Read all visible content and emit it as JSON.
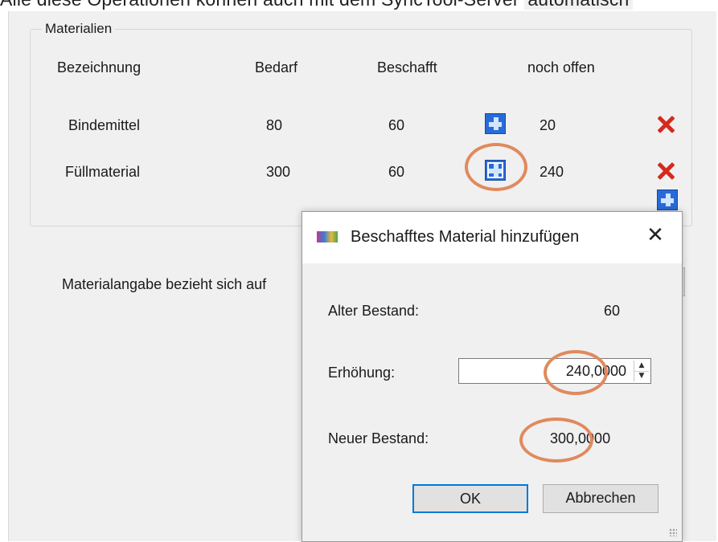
{
  "caption": {
    "text": "Alle diese Operationen können auch mit dem SyncTool-Server ",
    "highlight": "automatisch"
  },
  "group": {
    "title": "Materialien",
    "headers": {
      "name": "Bezeichnung",
      "need": "Bedarf",
      "procured": "Beschafft",
      "open": "noch offen"
    },
    "rows": [
      {
        "name": "Bindemittel",
        "need": "80",
        "procured": "60",
        "open": "20"
      },
      {
        "name": "Füllmaterial",
        "need": "300",
        "procured": "60",
        "open": "240"
      }
    ]
  },
  "material_reference_label": "Materialangabe bezieht sich auf",
  "dialog": {
    "title": "Beschafftes Material hinzufügen",
    "close_glyph": "✕",
    "old_stock_label": "Alter Bestand:",
    "old_stock_value": "60",
    "increase_label": "Erhöhung:",
    "increase_value": "240,0000",
    "new_stock_label": "Neuer Bestand:",
    "new_stock_value": "300,0000",
    "ok_label": "OK",
    "cancel_label": "Abbrechen",
    "spin_up": "▲",
    "spin_down": "▼"
  },
  "icons": {
    "add": "plus-icon",
    "delete": "delete-x-icon",
    "app": "app-icon"
  },
  "colors": {
    "highlight_ring": "#e08a5e",
    "add_button": "#2a6ad8",
    "delete": "#d42a1e",
    "default_button_border": "#0078d7"
  }
}
